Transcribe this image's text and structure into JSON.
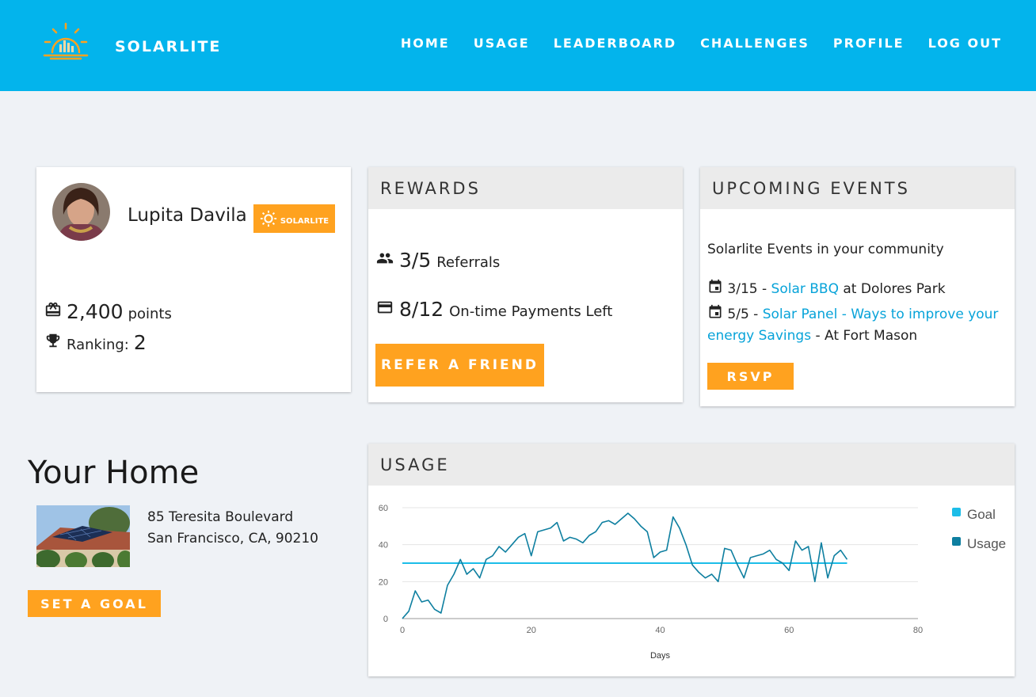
{
  "header": {
    "brand": "SOLARLITE",
    "nav": [
      "HOME",
      "USAGE",
      "LEADERBOARD",
      "CHALLENGES",
      "PROFILE",
      "LOG OUT"
    ]
  },
  "profile": {
    "name": "Lupita Davila",
    "badge_label": "SOLARLITE",
    "points_value": "2,400",
    "points_label": "points",
    "ranking_label": "Ranking:",
    "ranking_value": "2"
  },
  "rewards": {
    "title": "REWARDS",
    "referrals_value": "3/5",
    "referrals_label": "Referrals",
    "payments_value": "8/12",
    "payments_label": "On-time Payments Left",
    "button": "REFER A FRIEND"
  },
  "events": {
    "title": "UPCOMING EVENTS",
    "intro": "Solarlite Events in your community",
    "items": [
      {
        "date": "3/15 - ",
        "link": "Solar BBQ",
        "rest": " at Dolores Park"
      },
      {
        "date": "5/5 - ",
        "link": "Solar Panel - Ways to improve your energy Savings",
        "rest": " - At Fort Mason"
      }
    ],
    "button": "RSVP"
  },
  "home": {
    "title": "Your Home",
    "address_line1": "85 Teresita Boulevard",
    "address_line2": "San Francisco, CA, 90210",
    "button": "SET A GOAL"
  },
  "usage": {
    "title": "USAGE"
  },
  "colors": {
    "header": "#03b4ec",
    "accent": "#ffa21f",
    "goal": "#1cbde8",
    "usage": "#0e7fa0"
  },
  "chart_data": {
    "type": "line",
    "xlabel": "Days",
    "ylabel": "",
    "xlim": [
      0,
      80
    ],
    "ylim": [
      0,
      60
    ],
    "xticks": [
      0,
      20,
      40,
      60,
      80
    ],
    "yticks": [
      0,
      20,
      40,
      60
    ],
    "legend_position": "right",
    "series": [
      {
        "name": "Goal",
        "color": "#1cbde8",
        "x": [
          0,
          69
        ],
        "y": [
          30,
          30
        ]
      },
      {
        "name": "Usage",
        "color": "#0e7fa0",
        "x": [
          0,
          1,
          2,
          3,
          4,
          5,
          6,
          7,
          8,
          9,
          10,
          11,
          12,
          13,
          14,
          15,
          16,
          17,
          18,
          19,
          20,
          21,
          22,
          23,
          24,
          25,
          26,
          27,
          28,
          29,
          30,
          31,
          32,
          33,
          34,
          35,
          36,
          37,
          38,
          39,
          40,
          41,
          42,
          43,
          44,
          45,
          46,
          47,
          48,
          49,
          50,
          51,
          52,
          53,
          54,
          55,
          56,
          57,
          58,
          59,
          60,
          61,
          62,
          63,
          64,
          65,
          66,
          67,
          68,
          69
        ],
        "y": [
          0,
          4,
          15,
          9,
          10,
          5,
          3,
          18,
          24,
          32,
          24,
          27,
          22,
          32,
          34,
          39,
          36,
          40,
          44,
          46,
          34,
          47,
          48,
          49,
          52,
          42,
          44,
          43,
          41,
          45,
          47,
          52,
          53,
          51,
          54,
          57,
          54,
          50,
          47,
          33,
          36,
          37,
          55,
          49,
          40,
          29,
          25,
          22,
          24,
          20,
          38,
          37,
          29,
          22,
          33,
          34,
          35,
          37,
          32,
          30,
          26,
          42,
          37,
          39,
          20,
          41,
          22,
          34,
          37,
          32
        ]
      }
    ]
  }
}
